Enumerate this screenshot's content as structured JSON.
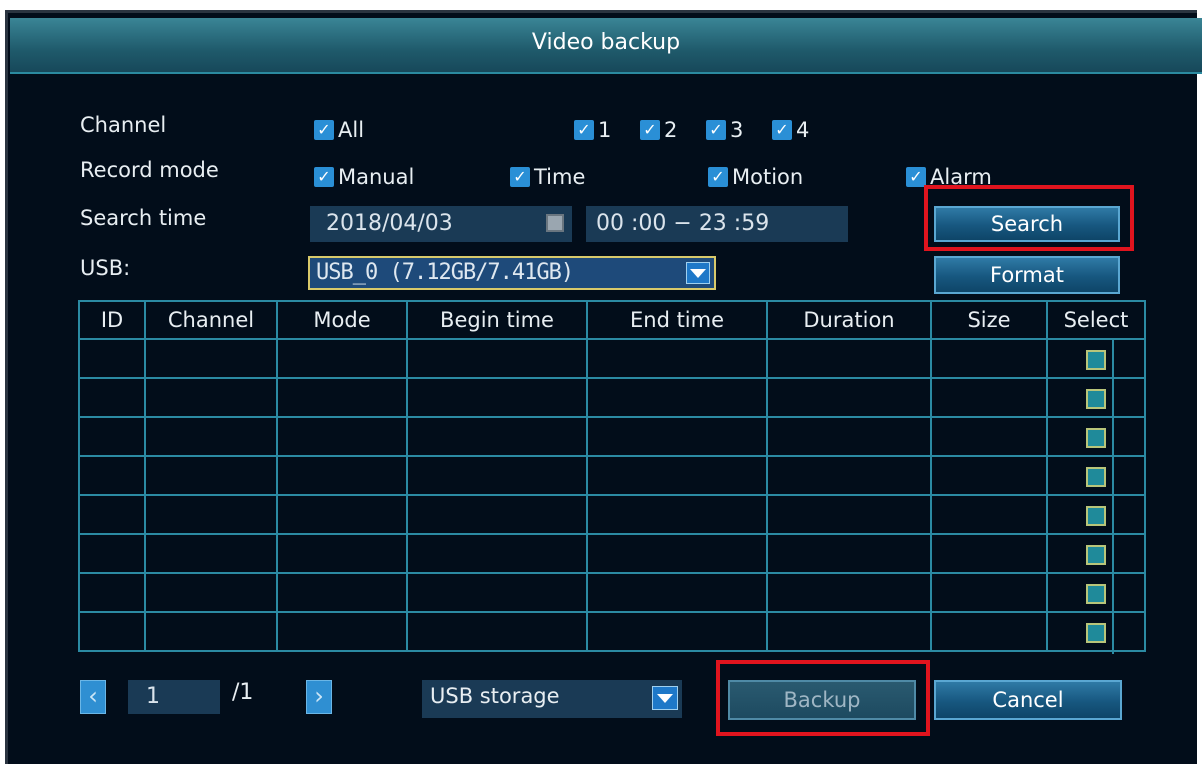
{
  "window": {
    "title": "Video backup"
  },
  "form": {
    "channel": {
      "label": "Channel",
      "all_label": "All",
      "options": [
        "1",
        "2",
        "3",
        "4"
      ]
    },
    "record_mode": {
      "label": "Record mode",
      "options": [
        "Manual",
        "Time",
        "Motion",
        "Alarm"
      ]
    },
    "search_time": {
      "label": "Search time",
      "date": "2018/04/03",
      "time_range": "00 :00 − 23 :59"
    },
    "usb": {
      "label": "USB:",
      "selected": "USB_0 (7.12GB/7.41GB)"
    }
  },
  "buttons": {
    "search": "Search",
    "format": "Format",
    "backup": "Backup",
    "cancel": "Cancel"
  },
  "table": {
    "headers": [
      "ID",
      "Channel",
      "Mode",
      "Begin time",
      "End time",
      "Duration",
      "Size",
      "Select"
    ],
    "row_count": 8
  },
  "pager": {
    "current_page": "1",
    "total": "/1"
  },
  "storage": {
    "selected": "USB storage"
  },
  "check_mark": "✓",
  "icons": {
    "calendar": "calendar-icon",
    "prev": "chevron-left-icon",
    "next": "chevron-right-icon"
  },
  "colors": {
    "background": "#020d1a",
    "titlebar": "#1f5a6b",
    "accent": "#2a8fd6",
    "highlight": "#e0141e"
  }
}
